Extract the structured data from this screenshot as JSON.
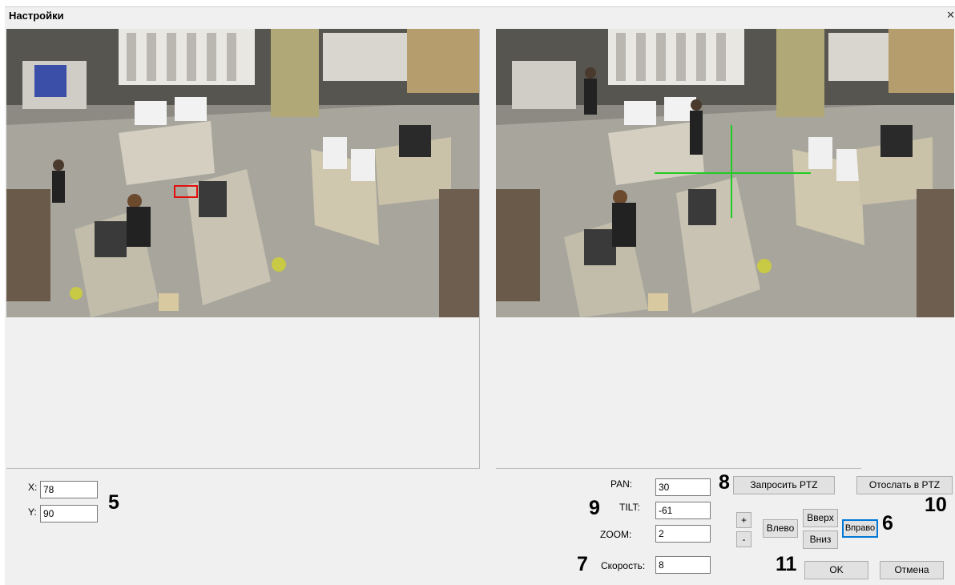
{
  "window": {
    "title": "Настройки",
    "close_glyph": "✕"
  },
  "left_view": {
    "x_label": "X:",
    "x_value": "78",
    "y_label": "Y:",
    "y_value": "90",
    "marker_color": "#e01010"
  },
  "right_view": {
    "crosshair_color": "#22cc22"
  },
  "ptz": {
    "pan_label": "PAN:",
    "pan_value": "30",
    "tilt_label": "TILT:",
    "tilt_value": "-61",
    "zoom_label": "ZOOM:",
    "zoom_value": "2",
    "speed_label": "Скорость:",
    "speed_value": "8"
  },
  "buttons": {
    "request_ptz": "Запросить PTZ",
    "send_ptz": "Отослать в PTZ",
    "zoom_plus": "+",
    "zoom_minus": "-",
    "left": "Влево",
    "up": "Вверх",
    "down": "Вниз",
    "right": "Вправо",
    "ok": "OK",
    "cancel": "Отмена"
  },
  "callouts": {
    "n5": "5",
    "n6": "6",
    "n7": "7",
    "n8": "8",
    "n9": "9",
    "n10": "10",
    "n11": "11"
  }
}
